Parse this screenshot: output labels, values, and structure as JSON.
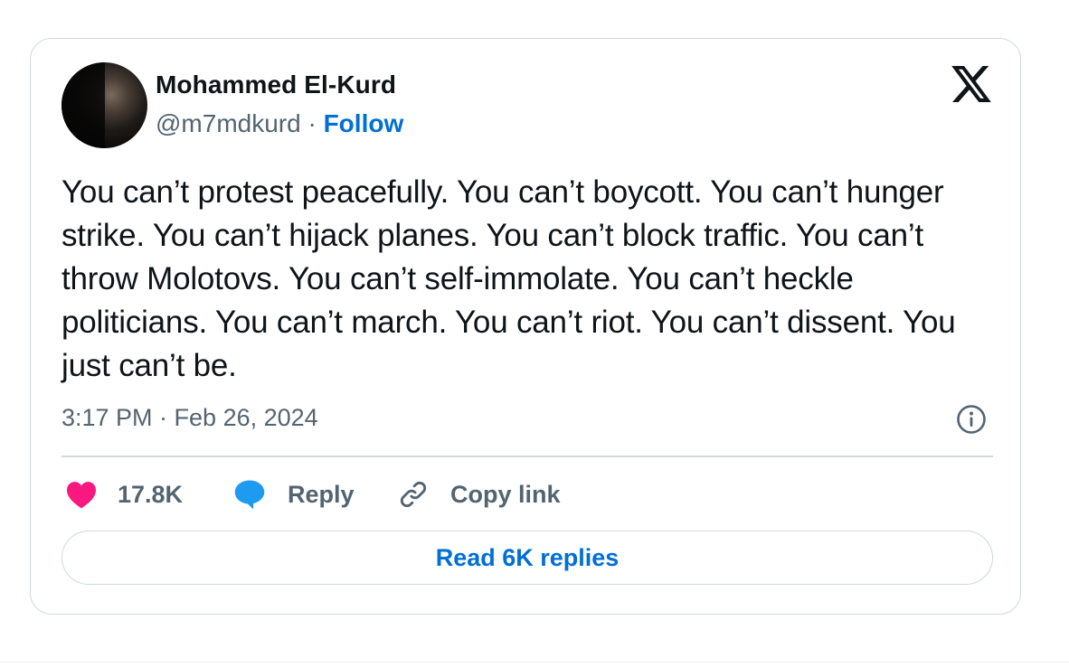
{
  "author": {
    "name": "Mohammed El-Kurd",
    "handle": "@m7mdkurd",
    "separator": " · ",
    "follow_label": "Follow"
  },
  "tweet": {
    "text": "You can’t protest peacefully. You can’t boycott. You can’t hunger strike. You can’t hijack planes. You can’t block traffic. You can’t throw Molotovs. You can’t self-immolate. You can’t heckle politicians. You can’t march. You can’t riot. You can’t dissent. You just can’t be.",
    "timestamp": "3:17 PM · Feb 26, 2024"
  },
  "actions": {
    "like_count": "17.8K",
    "reply_label": "Reply",
    "copy_link_label": "Copy link"
  },
  "read_replies_label": "Read 6K replies",
  "icons": {
    "brand": "x-logo-icon",
    "info": "info-icon",
    "like": "heart-icon",
    "reply": "speech-bubble-icon",
    "copy": "link-icon"
  },
  "colors": {
    "text": "#0f1419",
    "secondary": "#536471",
    "link": "#006fd6",
    "heart": "#f91880",
    "reply_icon": "#1d9bf0",
    "border": "#cfd9de"
  }
}
